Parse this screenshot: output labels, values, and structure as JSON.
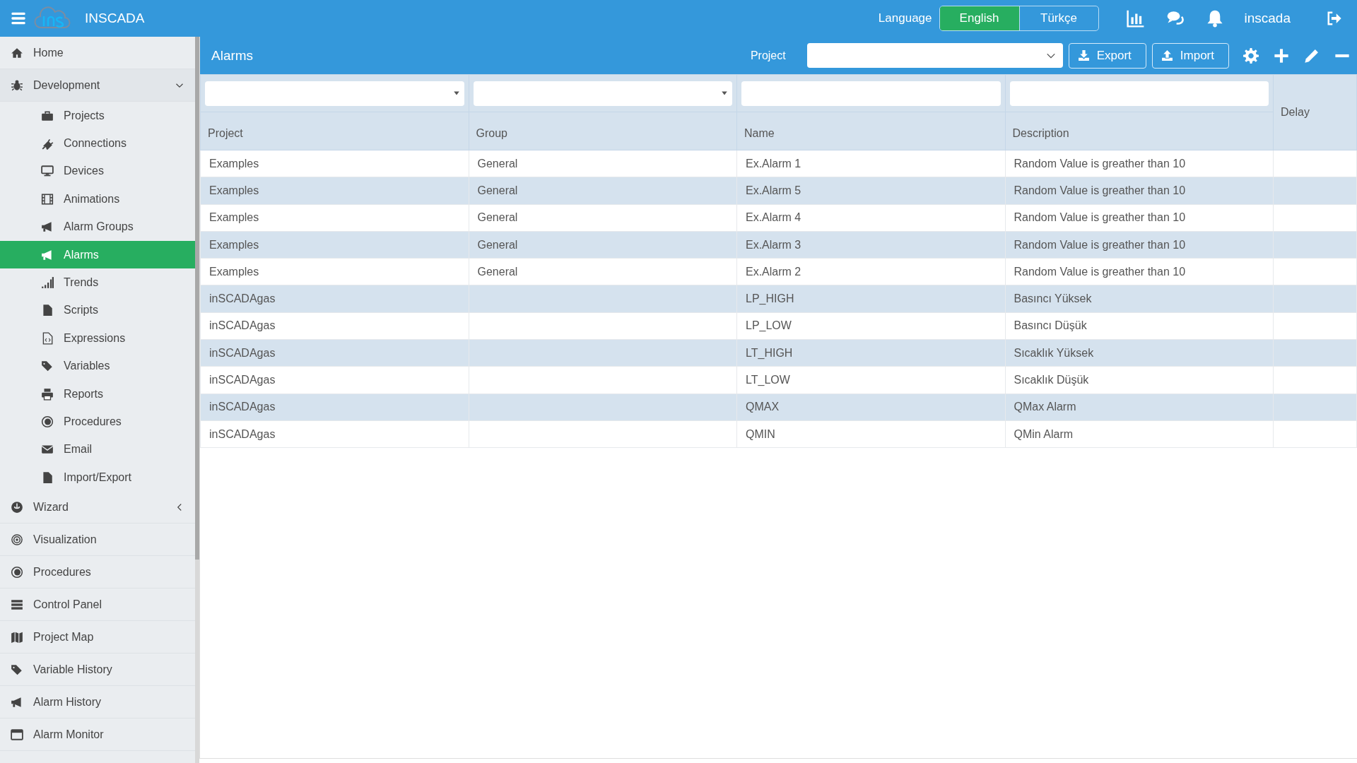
{
  "top_bar": {
    "app_name": "INSCADA",
    "language_label": "Language",
    "languages": [
      {
        "label": "English",
        "selected": true
      },
      {
        "label": "Türkçe",
        "selected": false
      }
    ],
    "user": "inscada"
  },
  "sidebar": {
    "items": [
      {
        "kind": "link",
        "label": "Home",
        "selected": false
      },
      {
        "kind": "group",
        "label": "Development",
        "expanded": true,
        "selected": false,
        "children": [
          {
            "label": "Projects",
            "selected": false
          },
          {
            "label": "Connections",
            "selected": false
          },
          {
            "label": "Devices",
            "selected": false
          },
          {
            "label": "Animations",
            "selected": false
          },
          {
            "label": "Alarm Groups",
            "selected": false
          },
          {
            "label": "Alarms",
            "selected": true
          },
          {
            "label": "Trends",
            "selected": false
          },
          {
            "label": "Scripts",
            "selected": false
          },
          {
            "label": "Expressions",
            "selected": false
          },
          {
            "label": "Variables",
            "selected": false
          },
          {
            "label": "Reports",
            "selected": false
          },
          {
            "label": "Procedures",
            "selected": false
          },
          {
            "label": "Email",
            "selected": false
          },
          {
            "label": "Import/Export",
            "selected": false
          }
        ]
      },
      {
        "kind": "group",
        "label": "Wizard",
        "expanded": false,
        "selected": false
      },
      {
        "kind": "link",
        "label": "Visualization",
        "selected": false
      },
      {
        "kind": "link",
        "label": "Procedures",
        "selected": false
      },
      {
        "kind": "link",
        "label": "Control Panel",
        "selected": false
      },
      {
        "kind": "link",
        "label": "Project Map",
        "selected": false
      },
      {
        "kind": "link",
        "label": "Variable History",
        "selected": false
      },
      {
        "kind": "link",
        "label": "Alarm History",
        "selected": false
      },
      {
        "kind": "link",
        "label": "Alarm Monitor",
        "selected": false
      }
    ]
  },
  "panel": {
    "title": "Alarms",
    "project_label": "Project",
    "buttons": [
      {
        "kind": "download",
        "label": "Export"
      },
      {
        "kind": "upload",
        "label": "Import"
      }
    ]
  },
  "table": {
    "columns": [
      {
        "label": "Project",
        "kind": "select"
      },
      {
        "label": "Group",
        "kind": "select"
      },
      {
        "label": "Name",
        "kind": "text"
      },
      {
        "label": "Description",
        "kind": "text"
      },
      {
        "label": "Delay",
        "kind": "plain"
      }
    ],
    "rows": [
      {
        "project": "Examples",
        "group": "General",
        "name": "Ex.Alarm 1",
        "description": "Random Value is greather than 10"
      },
      {
        "project": "Examples",
        "group": "General",
        "name": "Ex.Alarm 5",
        "description": "Random Value is greather than 10"
      },
      {
        "project": "Examples",
        "group": "General",
        "name": "Ex.Alarm 4",
        "description": "Random Value is greather than 10"
      },
      {
        "project": "Examples",
        "group": "General",
        "name": "Ex.Alarm 3",
        "description": "Random Value is greather than 10"
      },
      {
        "project": "Examples",
        "group": "General",
        "name": "Ex.Alarm 2",
        "description": "Random Value is greather than 10"
      },
      {
        "project": "inSCADAgas",
        "name": "LP_HIGH",
        "description": "Basıncı Yüksek"
      },
      {
        "project": "inSCADAgas",
        "name": "LP_LOW",
        "description": "Basıncı Düşük"
      },
      {
        "project": "inSCADAgas",
        "name": "LT_HIGH",
        "description": "Sıcaklık Yüksek"
      },
      {
        "project": "inSCADAgas",
        "name": "LT_LOW",
        "description": "Sıcaklık Düşük"
      },
      {
        "project": "inSCADAgas",
        "name": "QMAX",
        "description": "QMax Alarm"
      },
      {
        "project": "inSCADAgas",
        "name": "QMIN",
        "description": "QMin Alarm"
      }
    ]
  }
}
